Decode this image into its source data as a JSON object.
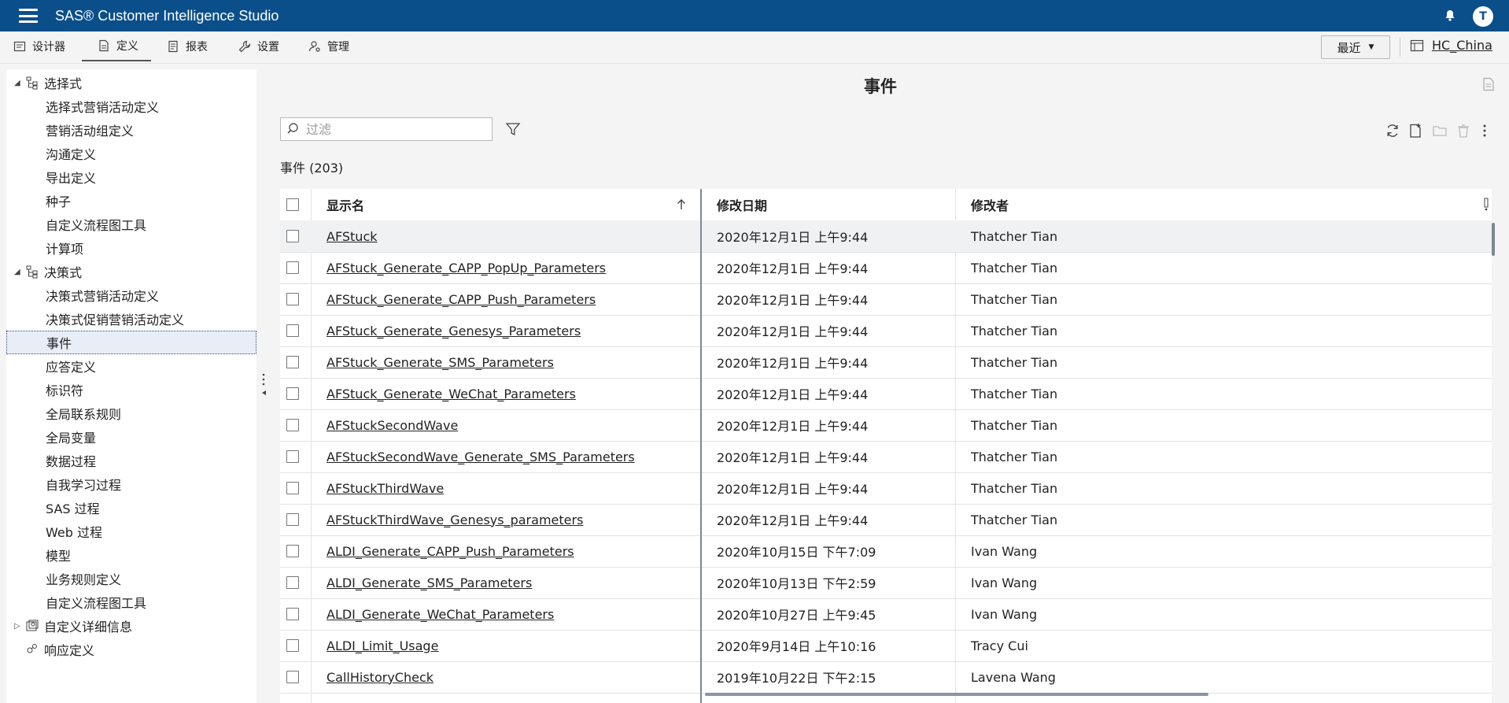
{
  "header": {
    "app_title": "SAS® Customer Intelligence Studio",
    "avatar_letter": "T"
  },
  "tabs": [
    {
      "label": "设计器",
      "icon": "designer-icon"
    },
    {
      "label": "定义",
      "icon": "definitions-icon"
    },
    {
      "label": "报表",
      "icon": "reports-icon"
    },
    {
      "label": "设置",
      "icon": "wrench-icon"
    },
    {
      "label": "管理",
      "icon": "admin-icon"
    }
  ],
  "toolbar": {
    "recent_label": "最近",
    "tenant": "HC_China"
  },
  "sidebar": {
    "groups": [
      {
        "label": "选择式",
        "items": [
          "选择式营销活动定义",
          "营销活动组定义",
          "沟通定义",
          "导出定义",
          "种子",
          "自定义流程图工具",
          "计算项"
        ]
      },
      {
        "label": "决策式",
        "items": [
          "决策式营销活动定义",
          "决策式促销营销活动定义",
          "事件",
          "应答定义",
          "标识符",
          "全局联系规则",
          "全局变量",
          "数据过程",
          "自我学习过程",
          "SAS 过程",
          "Web 过程",
          "模型",
          "业务规则定义",
          "自定义流程图工具"
        ]
      }
    ],
    "extra": [
      "自定义详细信息",
      "响应定义"
    ],
    "selected": "事件"
  },
  "main": {
    "title": "事件",
    "filter_placeholder": "过滤",
    "count_label": "事件 (203)",
    "columns": [
      "显示名",
      "修改日期",
      "修改者"
    ],
    "rows": [
      {
        "name": "AFStuck",
        "date": "2020年12月1日 上午9:44",
        "user": "Thatcher Tian"
      },
      {
        "name": "AFStuck_Generate_CAPP_PopUp_Parameters",
        "date": "2020年12月1日 上午9:44",
        "user": "Thatcher Tian"
      },
      {
        "name": "AFStuck_Generate_CAPP_Push_Parameters",
        "date": "2020年12月1日 上午9:44",
        "user": "Thatcher Tian"
      },
      {
        "name": "AFStuck_Generate_Genesys_Parameters",
        "date": "2020年12月1日 上午9:44",
        "user": "Thatcher Tian"
      },
      {
        "name": "AFStuck_Generate_SMS_Parameters",
        "date": "2020年12月1日 上午9:44",
        "user": "Thatcher Tian"
      },
      {
        "name": "AFStuck_Generate_WeChat_Parameters",
        "date": "2020年12月1日 上午9:44",
        "user": "Thatcher Tian"
      },
      {
        "name": "AFStuckSecondWave",
        "date": "2020年12月1日 上午9:44",
        "user": "Thatcher Tian"
      },
      {
        "name": "AFStuckSecondWave_Generate_SMS_Parameters",
        "date": "2020年12月1日 上午9:44",
        "user": "Thatcher Tian"
      },
      {
        "name": "AFStuckThirdWave",
        "date": "2020年12月1日 上午9:44",
        "user": "Thatcher Tian"
      },
      {
        "name": "AFStuckThirdWave_Genesys_parameters",
        "date": "2020年12月1日 上午9:44",
        "user": "Thatcher Tian"
      },
      {
        "name": "ALDI_Generate_CAPP_Push_Parameters",
        "date": "2020年10月15日 下午7:09",
        "user": "Ivan Wang"
      },
      {
        "name": "ALDI_Generate_SMS_Parameters",
        "date": "2020年10月13日 下午2:59",
        "user": "Ivan Wang"
      },
      {
        "name": "ALDI_Generate_WeChat_Parameters",
        "date": "2020年10月27日 上午9:45",
        "user": "Ivan Wang"
      },
      {
        "name": "ALDI_Limit_Usage",
        "date": "2020年9月14日 上午10:16",
        "user": "Tracy Cui"
      },
      {
        "name": "CallHistoryCheck",
        "date": "2019年10月22日 下午2:15",
        "user": "Lavena Wang"
      }
    ]
  },
  "colors": {
    "brand": "#0b4f8a",
    "selection": "#e8edf6"
  }
}
